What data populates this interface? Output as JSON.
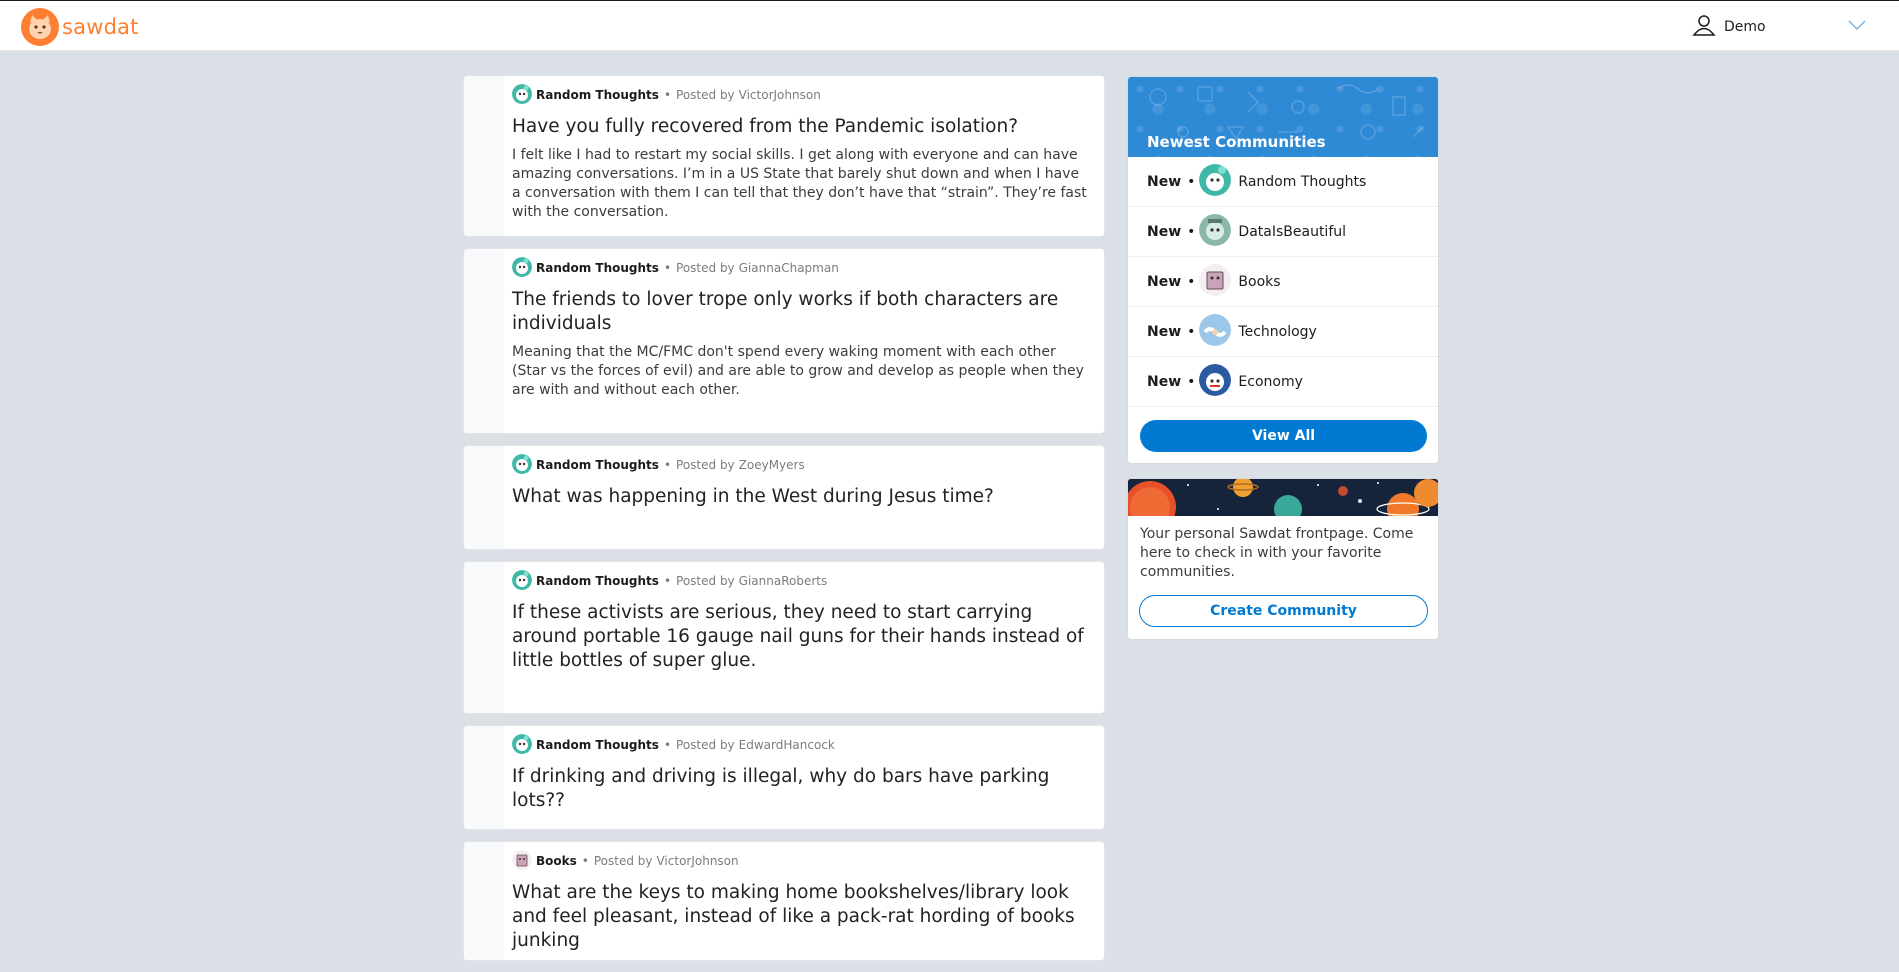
{
  "header": {
    "brand": "sawdat",
    "user_name": "Demo"
  },
  "posts": [
    {
      "community": "Random Thoughts",
      "community_icon": "random-thoughts-icon",
      "posted_by_label": "Posted by",
      "author": "VictorJohnson",
      "title": "Have you fully recovered from the Pandemic isolation?",
      "body": "I felt like I had to restart my social skills. I get along with everyone and can have amazing conversations. I’m in a US State that barely shut down and when I have a conversation with them I can tell that they don’t have that “strain”. They’re fast with the conversation."
    },
    {
      "community": "Random Thoughts",
      "community_icon": "random-thoughts-icon",
      "posted_by_label": "Posted by",
      "author": "GiannaChapman",
      "title": "The friends to lover trope only works if both characters are individuals",
      "body": "Meaning that the MC/FMC don't spend every waking moment with each other (Star vs the forces of evil) and are able to grow and develop as people when they are with and without each other."
    },
    {
      "community": "Random Thoughts",
      "community_icon": "random-thoughts-icon",
      "posted_by_label": "Posted by",
      "author": "ZoeyMyers",
      "title": "What was happening in the West during Jesus time?",
      "body": ""
    },
    {
      "community": "Random Thoughts",
      "community_icon": "random-thoughts-icon",
      "posted_by_label": "Posted by",
      "author": "GiannaRoberts",
      "title": "If these activists are serious, they need to start carrying around portable 16 gauge nail guns for their hands instead of little bottles of super glue.",
      "body": ""
    },
    {
      "community": "Random Thoughts",
      "community_icon": "random-thoughts-icon",
      "posted_by_label": "Posted by",
      "author": "EdwardHancock",
      "title": "If drinking and driving is illegal, why do bars have parking lots??",
      "body": ""
    },
    {
      "community": "Books",
      "community_icon": "books-icon",
      "posted_by_label": "Posted by",
      "author": "VictorJohnson",
      "title": "What are the keys to making home bookshelves/library look and feel pleasant, instead of like a pack-rat hording of books junking",
      "body": ""
    }
  ],
  "sidebar": {
    "newest_title": "Newest Communities",
    "new_label": "New",
    "communities": [
      {
        "name": "Random Thoughts",
        "icon": "random-thoughts-icon"
      },
      {
        "name": "DataIsBeautiful",
        "icon": "data-is-beautiful-icon"
      },
      {
        "name": "Books",
        "icon": "books-icon"
      },
      {
        "name": "Technology",
        "icon": "technology-icon"
      },
      {
        "name": "Economy",
        "icon": "economy-icon"
      }
    ],
    "view_all_label": "View All",
    "home_text": "Your personal Sawdat frontpage. Come here to check in with your favorite communities.",
    "create_community_label": "Create Community"
  },
  "colors": {
    "brand_orange": "#ff7f32",
    "accent_blue": "#0079d3",
    "page_bg": "#dae0e6"
  }
}
